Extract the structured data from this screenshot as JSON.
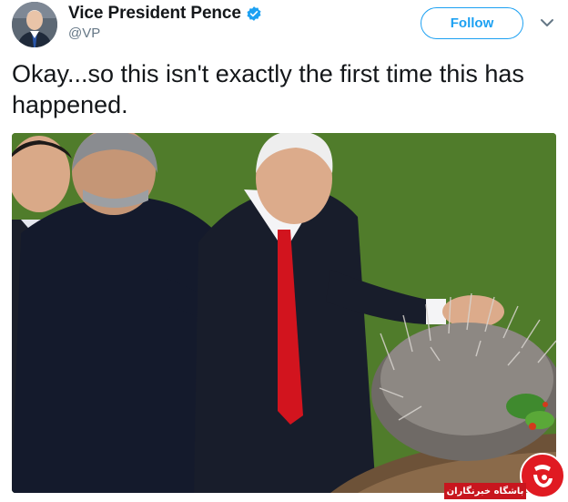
{
  "tweet": {
    "author": {
      "display_name": "Vice President Pence",
      "handle": "@VP",
      "verified": true,
      "avatar_icon": "profile-photo"
    },
    "follow_button": {
      "label": "Follow"
    },
    "menu_icon": "chevron-down-icon",
    "text": "Okay...so this isn't exactly the first time this has happened.",
    "media": {
      "kind": "photo",
      "background_color": "#4e7a2a"
    }
  },
  "watermark": {
    "label": "باشگاه خبرنگاران"
  },
  "colors": {
    "accent": "#1da1f2",
    "text": "#14171a",
    "secondary_text": "#657786",
    "watermark_red": "#e01a22"
  }
}
